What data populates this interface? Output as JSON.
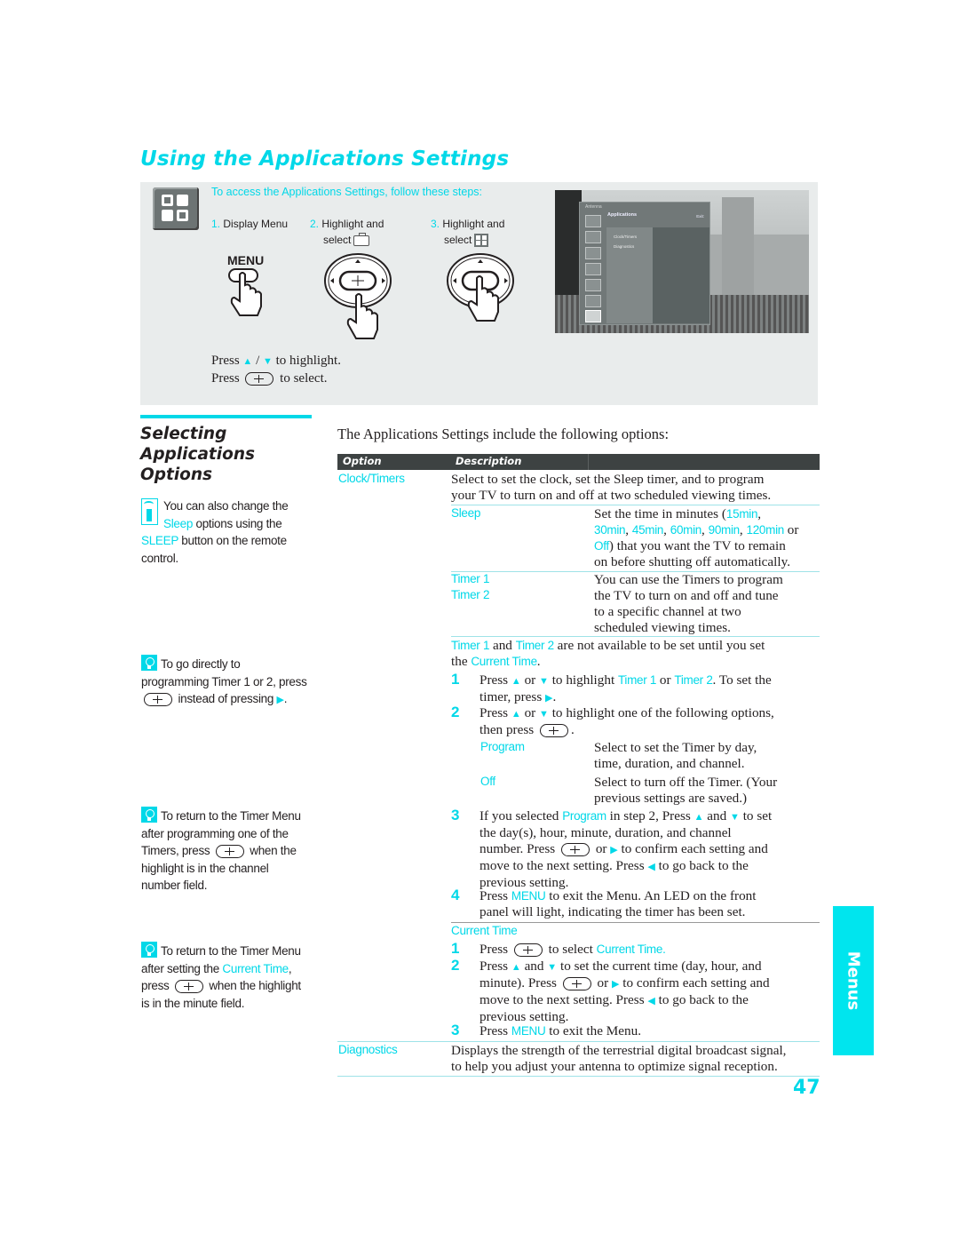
{
  "page": {
    "title": "Using the Applications Settings",
    "page_number": "47",
    "side_tab": "Menus"
  },
  "access": {
    "heading": "To access the Applications Settings, follow these steps:",
    "steps": [
      {
        "num": "1.",
        "text": "Display Menu"
      },
      {
        "num": "2.",
        "text": "Highlight and",
        "text2": "select",
        "icon": "toolbox-icon"
      },
      {
        "num": "3.",
        "text": "Highlight and",
        "text2": "select",
        "icon": "applications-icon"
      }
    ],
    "menu_button_label": "MENU",
    "press_highlight": {
      "pre": "Press",
      "sep": "/",
      "post": "to highlight."
    },
    "press_select": {
      "pre": "Press",
      "post": "to select."
    }
  },
  "tv_menu": {
    "source": "Antenna",
    "header": "Applications",
    "exit": "Exit:",
    "items": [
      "Clock/Timers",
      "Diagnostics"
    ]
  },
  "section": {
    "title_lines": [
      "Selecting",
      "Applications",
      "Options"
    ]
  },
  "notes": [
    {
      "icon": "remote-icon",
      "parts": [
        {
          "t": "You can also change the "
        },
        {
          "t": "Sleep",
          "c": 1
        },
        {
          "t": " options using the "
        },
        {
          "t": "SLEEP",
          "c": 1
        },
        {
          "t": " button on the remote control."
        }
      ]
    },
    {
      "icon": "tip-icon",
      "parts": [
        {
          "t": "To go directly to programming Timer 1 or 2, press "
        },
        {
          "btn": 1
        },
        {
          "t": " instead of pressing "
        },
        {
          "arrow": "right"
        },
        {
          "t": "."
        }
      ]
    },
    {
      "icon": "tip-icon",
      "parts": [
        {
          "t": "To return to the Timer Menu after programming one of the Timers, press "
        },
        {
          "btn": 1
        },
        {
          "t": " when the highlight is in the channel number field."
        }
      ]
    },
    {
      "icon": "tip-icon",
      "parts": [
        {
          "t": "To return to the Timer Menu after setting the "
        },
        {
          "t": "Current Time",
          "c": 1
        },
        {
          "t": ", press "
        },
        {
          "btn": 1
        },
        {
          "t": " when the highlight is in the minute field."
        }
      ]
    }
  ],
  "table": {
    "intro": "The Applications Settings include the following options:",
    "headers": [
      "Option",
      "Description"
    ],
    "clock_timers": {
      "option": "Clock/Timers",
      "desc_line1": "Select to set the clock, set the Sleep timer, and to program",
      "desc_line2": "your TV to turn on and off at two scheduled viewing times.",
      "sleep": {
        "label": "Sleep",
        "l1_pre": "Set the time in minutes (",
        "values": [
          "15min",
          "30min",
          "45min",
          "60min",
          "90min",
          "120min",
          "Off"
        ],
        "l2_or": " or",
        "l3_post": ") that you want the TV to remain",
        "l4": "on before shutting off automatically."
      },
      "timers": {
        "labels": [
          "Timer 1",
          "Timer 2"
        ],
        "desc": [
          "You can use the Timers to program",
          "the TV to turn on and off and tune",
          "to a specific channel at two",
          "scheduled viewing times."
        ],
        "note_and": " and ",
        "note_rest": " are not available to be set until you set",
        "note_the": "the ",
        "note_current": "Current Time",
        "note_end": ".",
        "step1": {
          "num": "1",
          "a": "Press",
          "b": "or",
          "c": "to highlight",
          "t1": "Timer 1",
          "or": "or",
          "t2": "Timer 2",
          "d": ". To set the",
          "e": "timer, press",
          "f": "."
        },
        "step2": {
          "num": "2",
          "a": "Press",
          "b": "or",
          "c": "to highlight one of the following options,",
          "e": "then press",
          "f": "."
        },
        "sub_options": [
          {
            "label": "Program",
            "desc": [
              "Select to set the Timer by day,",
              "time, duration, and channel."
            ]
          },
          {
            "label": "Off",
            "desc": [
              "Select to turn off the Timer. (Your",
              "previous settings are saved.)"
            ]
          }
        ],
        "step3": {
          "num": "3",
          "a": "If you selected",
          "prog": "Program",
          "b": "in step 2, Press",
          "c": "and",
          "d": "to set",
          "l2": "the day(s), hour, minute, duration, and channel",
          "l3a": "number. Press",
          "l3b": "or",
          "l3c": "to confirm each setting and",
          "l4a": "move to the next setting. Press",
          "l4b": "to go back to the",
          "l5": "previous setting."
        },
        "step4": {
          "num": "4",
          "a": "Press",
          "menu": "MENU",
          "b": "to exit the Menu. An LED on the front",
          "l2": "panel will light, indicating the timer has been set."
        }
      },
      "current_time": {
        "label": "Current Time",
        "step1": {
          "num": "1",
          "a": "Press",
          "b": "to select",
          "c": "Current Time."
        },
        "step2": {
          "num": "2",
          "a": "Press",
          "b": "and",
          "c": "to set the current time (day, hour, and",
          "l2a": "minute). Press",
          "l2b": "or",
          "l2c": "to confirm each setting and",
          "l3a": "move to the next setting. Press",
          "l3b": "to go back to the",
          "l4": "previous setting."
        },
        "step3": {
          "num": "3",
          "a": "Press",
          "menu": "MENU",
          "b": "to exit the Menu."
        }
      }
    },
    "diagnostics": {
      "option": "Diagnostics",
      "desc_line1": "Displays the strength of the terrestrial digital broadcast signal,",
      "desc_line2": "to help you adjust your antenna to optimize signal reception."
    }
  },
  "colors": {
    "accent": "#00d8e8",
    "table_header": "#3d4242",
    "panel": "#e9ecec"
  }
}
